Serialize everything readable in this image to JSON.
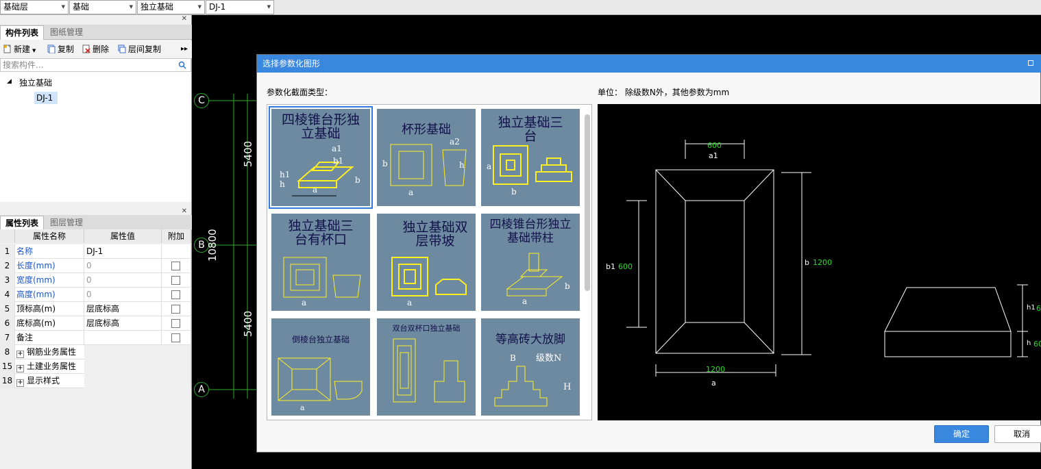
{
  "topbar": {
    "combos": [
      "基础层",
      "基础",
      "独立基础",
      "DJ-1"
    ]
  },
  "component_panel": {
    "tabs": [
      "构件列表",
      "图纸管理"
    ],
    "toolbar": {
      "new": "新建",
      "copy": "复制",
      "delete": "删除",
      "floor_copy": "层间复制"
    },
    "search_placeholder": "搜索构件...",
    "tree": {
      "category": "独立基础",
      "item": "DJ-1"
    }
  },
  "property_panel": {
    "tabs": [
      "属性列表",
      "图层管理"
    ],
    "columns": [
      "属性名称",
      "属性值",
      "附加"
    ],
    "rows": [
      {
        "num": "1",
        "name": "名称",
        "value": "DJ-1"
      },
      {
        "num": "2",
        "name": "长度(mm)",
        "value": "0"
      },
      {
        "num": "3",
        "name": "宽度(mm)",
        "value": "0"
      },
      {
        "num": "4",
        "name": "高度(mm)",
        "value": "0"
      },
      {
        "num": "5",
        "name": "顶标高(m)",
        "value": "层底标高"
      },
      {
        "num": "6",
        "name": "底标高(m)",
        "value": "层底标高"
      },
      {
        "num": "7",
        "name": "备注",
        "value": ""
      },
      {
        "num": "8",
        "name": "钢筋业务属性",
        "value": ""
      },
      {
        "num": "15",
        "name": "土建业务属性",
        "value": ""
      },
      {
        "num": "18",
        "name": "显示样式",
        "value": ""
      }
    ]
  },
  "canvas": {
    "axes": [
      "C",
      "B",
      "A"
    ],
    "dims": {
      "top": "5400",
      "total": "10800",
      "bottom": "5400"
    }
  },
  "dialog": {
    "title": "选择参数化图形",
    "type_label": "参数化截面类型：",
    "unit_label": "单位：  除级数N外，其他参数为mm",
    "shapes": [
      {
        "title": "四棱锥台形独立基础"
      },
      {
        "title": "杯形基础"
      },
      {
        "title": "独立基础三台"
      },
      {
        "title": "独立基础三台有杯口"
      },
      {
        "title": "独立基础双层带坡"
      },
      {
        "title": "四棱锥台形独立基础带柱"
      },
      {
        "title": "倒棱台独立基础"
      },
      {
        "title": "双台双杯口独立基础"
      },
      {
        "title": "等高砖大放脚"
      }
    ],
    "preview": {
      "a1_val": "600",
      "a1": "a1",
      "b1": "b1",
      "b1_val": "600",
      "b": "b",
      "b_val": "1200",
      "a_val": "1200",
      "a": "a",
      "h1": "h1",
      "h1_val": "6",
      "h": "h",
      "h_val": "60"
    },
    "ok": "确定",
    "cancel": "取消"
  },
  "colors": {
    "accent": "#3a87e0",
    "dim_green": "#22e022",
    "tile_bg": "#6e8aa0"
  }
}
